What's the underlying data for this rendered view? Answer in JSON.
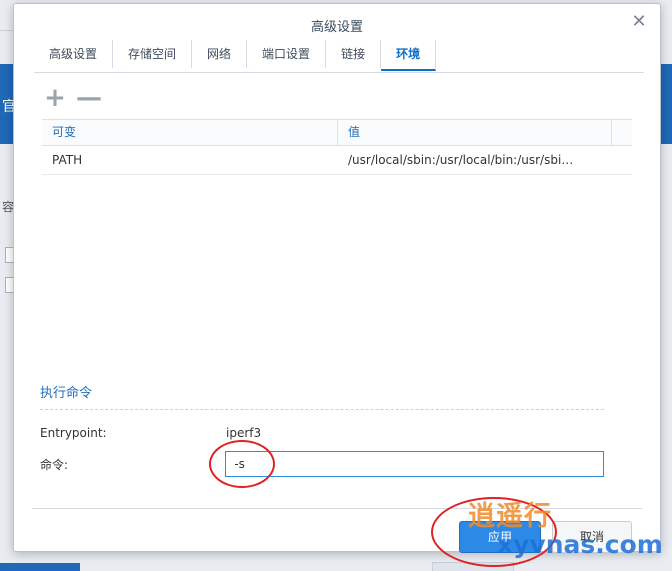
{
  "dialog": {
    "title": "高级设置"
  },
  "tabs": [
    {
      "label": "高级设置"
    },
    {
      "label": "存储空间"
    },
    {
      "label": "网络"
    },
    {
      "label": "端口设置"
    },
    {
      "label": "链接"
    },
    {
      "label": "环境"
    }
  ],
  "active_tab": "环境",
  "toolbar": {
    "add_glyph": "+",
    "remove_glyph": "—"
  },
  "env_table": {
    "headers": {
      "variable": "可变",
      "value": "值"
    },
    "rows": [
      {
        "variable": "PATH",
        "value": "/usr/local/sbin:/usr/local/bin:/usr/sbi…"
      }
    ]
  },
  "exec": {
    "section_title": "执行命令",
    "entrypoint_label": "Entrypoint:",
    "entrypoint_value": "iperf3",
    "command_label": "命令:",
    "command_value": "-s"
  },
  "footer": {
    "apply_label": "应用",
    "cancel_label": "取消"
  },
  "background": {
    "fragment1": "官",
    "fragment2": "容"
  },
  "watermark": {
    "line1": "逍遥行",
    "line2": "xyvnas.com"
  },
  "colors": {
    "accent": "#0f6fc6",
    "primary_button": "#2c8ae6",
    "annotation": "#e02222"
  }
}
